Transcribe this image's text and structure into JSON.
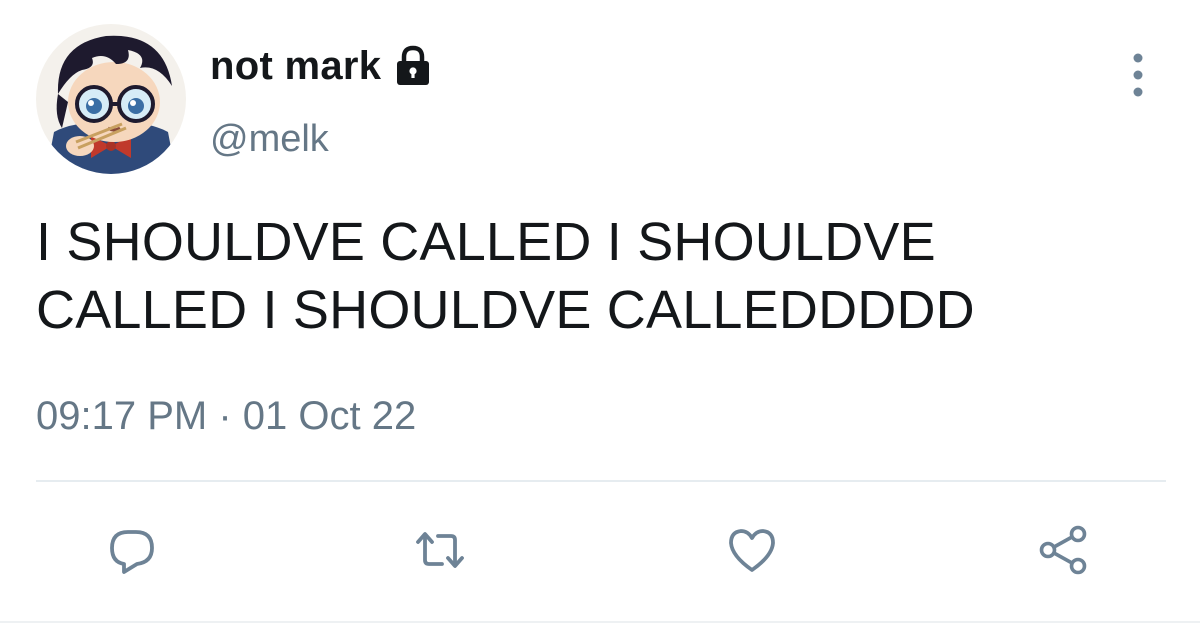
{
  "tweet": {
    "display_name": "not mark",
    "handle": "@melk",
    "protected": true,
    "text": "I SHOULDVE CALLED I SHOULDVE CALLED I SHOULDVE CALLEDDDDD",
    "timestamp": "09:17 PM · 01 Oct 22"
  },
  "icons": {
    "lock": "lock-icon",
    "more": "more-vertical-icon",
    "reply": "reply-icon",
    "retweet": "retweet-icon",
    "like": "heart-icon",
    "share": "share-icon"
  },
  "colors": {
    "text": "#14171a",
    "secondary": "#657786",
    "divider": "#e6ecf0",
    "icon": "#6e8396"
  }
}
